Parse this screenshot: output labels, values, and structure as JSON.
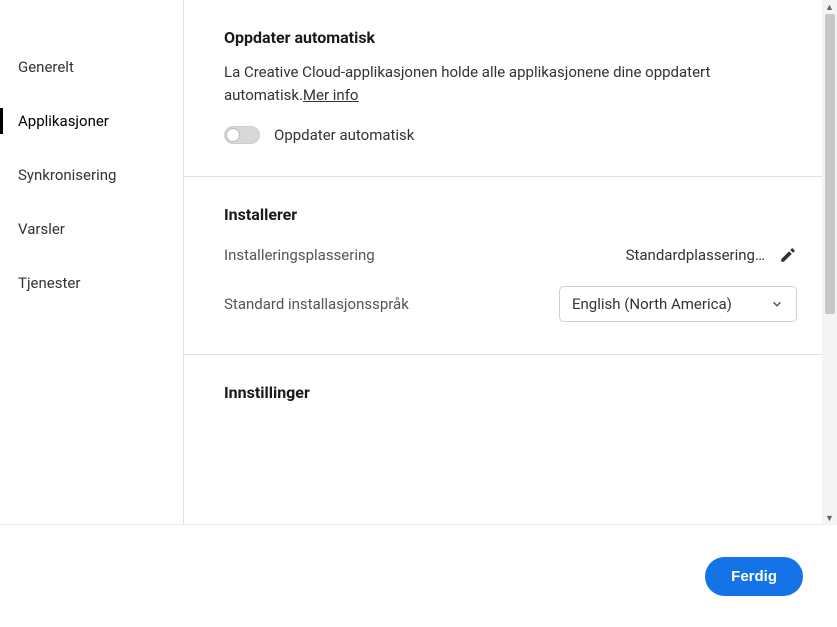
{
  "sidebar": {
    "items": [
      {
        "label": "Generelt"
      },
      {
        "label": "Applikasjoner"
      },
      {
        "label": "Synkronisering"
      },
      {
        "label": "Varsler"
      },
      {
        "label": "Tjenester"
      }
    ]
  },
  "sections": {
    "autoupdate": {
      "title": "Oppdater automatisk",
      "desc_prefix": "La Creative Cloud-applikasjonen holde alle applikasjonene dine oppdatert automatisk.",
      "more_info": "Mer info",
      "toggle_label": "Oppdater automatisk"
    },
    "install": {
      "title": "Installerer",
      "location_label": "Installeringsplassering",
      "location_value": "Standardplassering…",
      "lang_label": "Standard installasjonsspråk",
      "lang_value": "English (North America)"
    },
    "settings": {
      "title": "Innstillinger"
    }
  },
  "footer": {
    "done": "Ferdig"
  }
}
